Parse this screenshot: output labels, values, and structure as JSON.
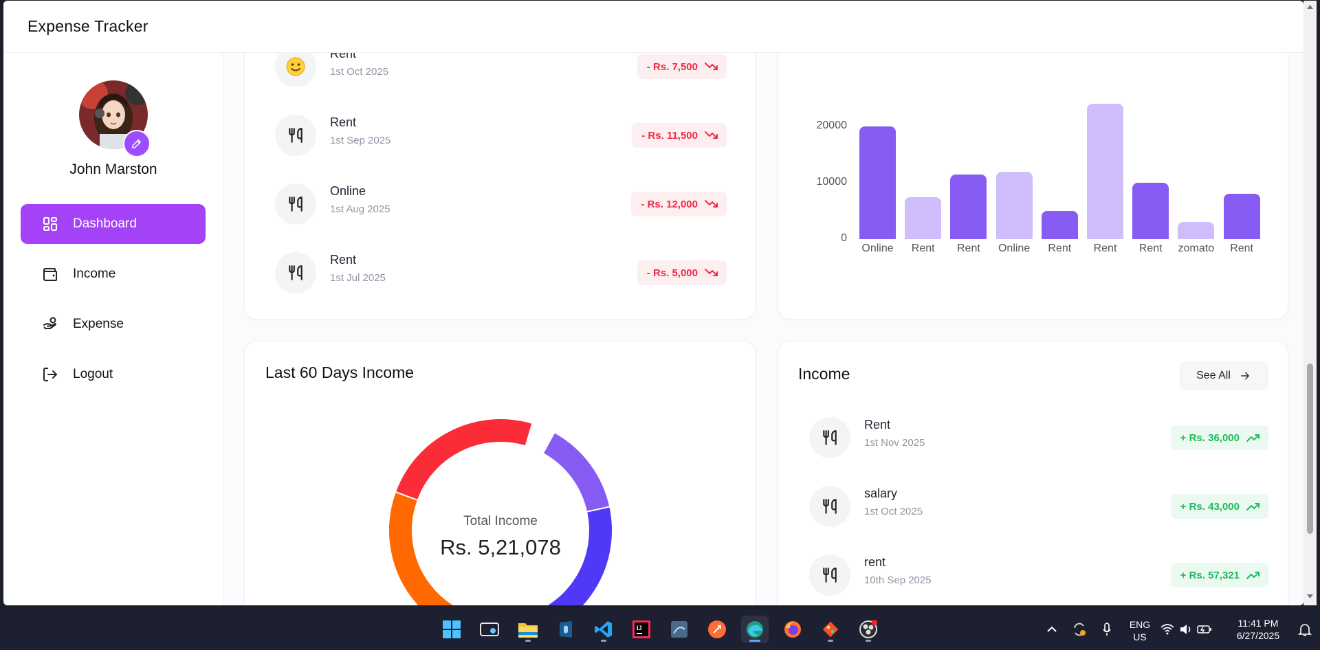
{
  "app": {
    "title": "Expense Tracker"
  },
  "user": {
    "name": "John Marston"
  },
  "sidebar": {
    "items": [
      {
        "label": "Dashboard",
        "icon": "dashboard-icon",
        "active": true
      },
      {
        "label": "Income",
        "icon": "wallet-icon",
        "active": false
      },
      {
        "label": "Expense",
        "icon": "hand-coins-icon",
        "active": false
      },
      {
        "label": "Logout",
        "icon": "logout-icon",
        "active": false
      }
    ]
  },
  "expenses": {
    "items": [
      {
        "name": "Rent",
        "date": "1st Oct 2025",
        "amount": "- Rs. 7,500",
        "icon": "smiley-emoji-icon"
      },
      {
        "name": "Rent",
        "date": "1st Sep 2025",
        "amount": "- Rs. 11,500",
        "icon": "utensils-icon"
      },
      {
        "name": "Online",
        "date": "1st Aug 2025",
        "amount": "- Rs. 12,000",
        "icon": "utensils-icon"
      },
      {
        "name": "Rent",
        "date": "1st Jul 2025",
        "amount": "- Rs. 5,000",
        "icon": "utensils-icon"
      }
    ]
  },
  "bar_chart": {
    "ticks": [
      "20000",
      "10000",
      "0"
    ]
  },
  "income_chart": {
    "title": "Last 60 Days Income",
    "center_label": "Total Income",
    "center_value": "Rs. 5,21,078"
  },
  "income_list": {
    "title": "Income",
    "see_all": "See All",
    "items": [
      {
        "name": "Rent",
        "date": "1st Nov 2025",
        "amount": "+ Rs. 36,000",
        "icon": "utensils-icon"
      },
      {
        "name": "salary",
        "date": "1st Oct 2025",
        "amount": "+ Rs. 43,000",
        "icon": "utensils-icon"
      },
      {
        "name": "rent",
        "date": "10th Sep 2025",
        "amount": "+ Rs. 57,321",
        "icon": "utensils-icon"
      }
    ]
  },
  "chart_data": [
    {
      "type": "bar",
      "categories": [
        "Online",
        "Rent",
        "Rent",
        "Online",
        "Rent",
        "Rent",
        "Rent",
        "zomato",
        "Rent"
      ],
      "values": [
        20000,
        7500,
        11500,
        12000,
        5000,
        24000,
        10000,
        3000,
        8000
      ],
      "ylim": [
        0,
        24000
      ],
      "yticks": [
        0,
        10000,
        20000
      ],
      "colors": [
        "#875cf5",
        "#cfbefb",
        "#875cf5",
        "#cfbefb",
        "#875cf5",
        "#cfbefb",
        "#875cf5",
        "#cfbefb",
        "#875cf5"
      ],
      "grid": false
    },
    {
      "type": "pie",
      "title": "Last 60 Days Income",
      "segments": [
        {
          "value": 0.136,
          "color": "#875cf5"
        },
        {
          "value": 0.25,
          "color": "#4f39f6"
        },
        {
          "value": 0.34,
          "color": "#ff6900"
        },
        {
          "value": 0.24,
          "color": "#fa2c37"
        }
      ]
    }
  ],
  "taskbar": {
    "icons": [
      "windows-start-icon",
      "widgets-icon",
      "file-explorer-icon",
      "mysql-workbench-icon",
      "vscode-icon",
      "intellij-icon",
      "dbeaver-icon",
      "postman-icon",
      "edge-browser-icon",
      "firefox-icon",
      "git-icon",
      "obs-icon"
    ],
    "tray": {
      "lang1": "ENG",
      "lang2": "US",
      "time": "11:41 PM",
      "date": "6/27/2025"
    }
  }
}
